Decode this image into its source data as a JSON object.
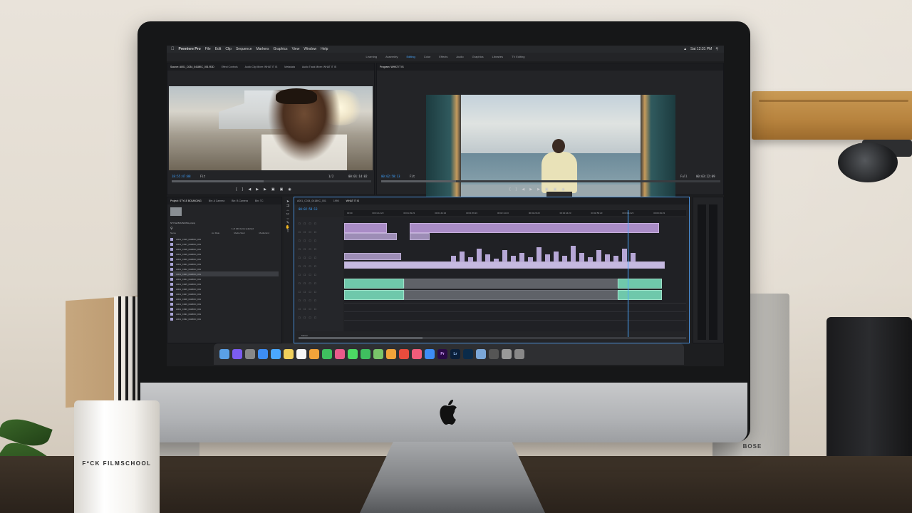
{
  "scene": {
    "mug_text": "F*CK FILMSCHOOL",
    "speaker_logo": "BOSE"
  },
  "menubar": {
    "items": [
      "Premiere Pro",
      "File",
      "Edit",
      "Clip",
      "Sequence",
      "Markers",
      "Graphics",
      "View",
      "Window",
      "Help"
    ],
    "clock": "Sat 12:31 PM"
  },
  "workspaces": {
    "items": [
      "Learning",
      "Assembly",
      "Editing",
      "Color",
      "Effects",
      "Audio",
      "Graphics",
      "Libraries",
      "TV Editing"
    ],
    "active": "Editing"
  },
  "source_panel": {
    "tabs": [
      "Source: A001_C034_0418KC_001.R3D",
      "Effect Controls",
      "Audio Clip Mixer: WHAT IT IS",
      "Metadata",
      "Audio Track Mixer: WHAT IT IS"
    ],
    "timecode_in": "18:55:47:08",
    "fit": "Fit",
    "fraction": "1/2",
    "timecode_out": "00:01:14:02"
  },
  "program_panel": {
    "tab": "Program: WHAT IT IS",
    "timecode_in": "00:02:58:13",
    "fit": "Fit",
    "fraction": "Full",
    "timecode_out": "00:03:22:09"
  },
  "project_panel": {
    "tabs": [
      "Project: STYLE BOUNCING",
      "Bin: A Camera",
      "Bin: B Camera",
      "Bin: TC"
    ],
    "project_file": "STYLE BOUNCING.prproj",
    "items_selected": "1 of 121 items selected",
    "columns": [
      "Name",
      "ion Rate",
      "Media Start",
      "Media End"
    ],
    "rows": [
      "A001_C016_0418KD_001",
      "A001_C017_0418KD_001",
      "A001_C018_0418KD_001",
      "A001_C019_0418KD_001",
      "A001_C020_0418KD_001",
      "A001_C021_0418KD_001",
      "A001_C022_0418KD_001",
      "A001_C023_0418KD_001",
      "A001_C024_0418KD_001",
      "A001_C025_0418KD_001",
      "A001_C026_0418KD_001",
      "A001_C027_0418KD_001",
      "A001_C028_0418KD_001",
      "A001_C029_0418KD_001",
      "A001_C030_0418KD_001",
      "A001_C031_0418KD_001",
      "A001_C032_0418KD_001"
    ],
    "selected_index": 7
  },
  "timeline_panel": {
    "tab": "A001_C034_0418KC_001",
    "tab2": "1990",
    "sequence_tab": "WHAT IT IS",
    "timecode": "00:02:58:13",
    "ruler": [
      "00:00",
      "00:01:14:23",
      "00:01:29:23",
      "00:01:44:23",
      "00:01:59:23",
      "00:02:14:23",
      "00:02:29:23",
      "00:02:44:23",
      "00:02:59:23",
      "00:03:14:23",
      "00:03:29:23"
    ],
    "master_label": "Master"
  },
  "dock": {
    "icons": [
      "finder-icon",
      "siri-icon",
      "launchpad-icon",
      "safari-icon",
      "mail-icon",
      "notes-icon",
      "calendar-icon",
      "pages-icon",
      "numbers-icon",
      "photos-icon",
      "messages-icon",
      "facetime-icon",
      "maps-icon",
      "keynote-icon",
      "news-icon",
      "music-icon",
      "app-store-icon",
      "premiere-icon",
      "lightroom-icon",
      "photoshop-icon",
      "preview-icon",
      "quicktime-icon",
      "screenshot-icon",
      "trash-icon"
    ],
    "premiere_label": "Pr",
    "lightroom_label": "Lr"
  }
}
